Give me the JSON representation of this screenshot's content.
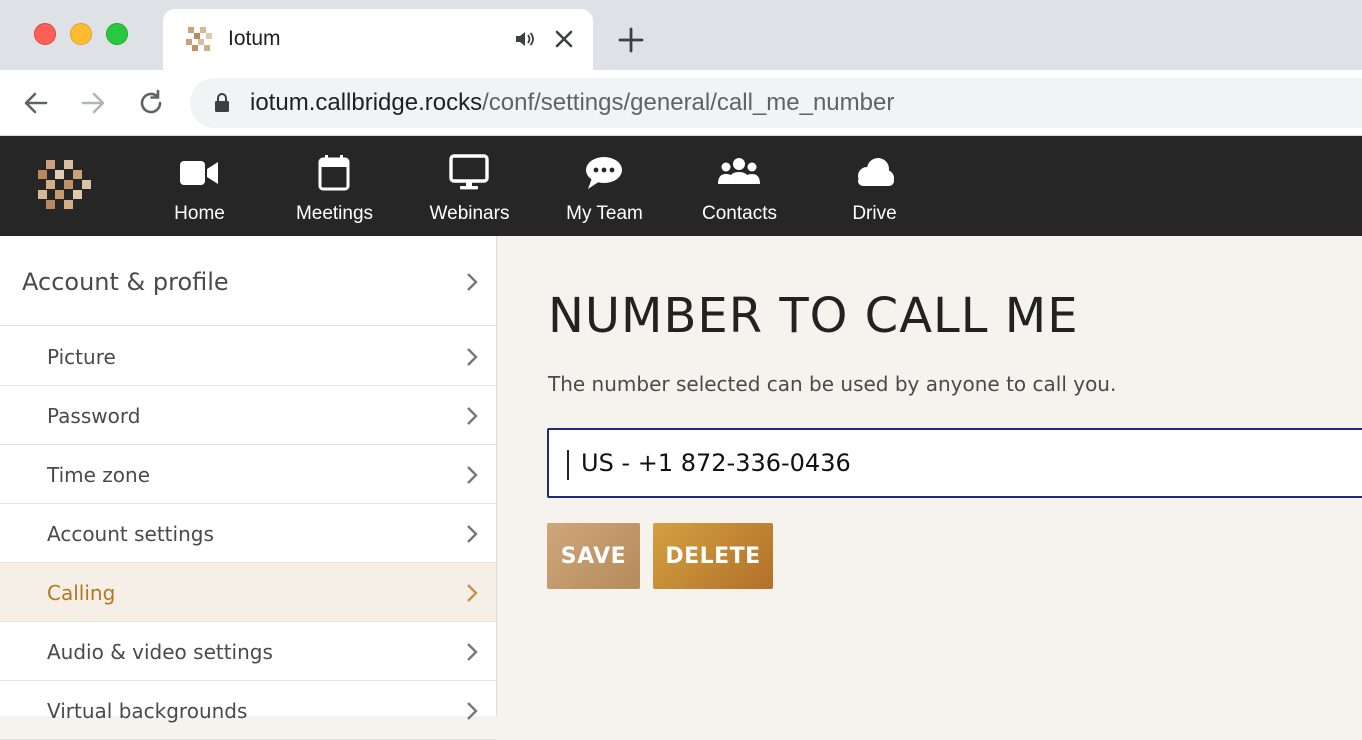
{
  "browser": {
    "tab": {
      "title": "Iotum"
    },
    "url": {
      "host": "iotum.callbridge.rocks",
      "path": "/conf/settings/general/call_me_number"
    }
  },
  "app": {
    "nav": [
      {
        "label": "Home",
        "icon": "video-camera-icon"
      },
      {
        "label": "Meetings",
        "icon": "calendar-icon"
      },
      {
        "label": "Webinars",
        "icon": "monitor-icon"
      },
      {
        "label": "My Team",
        "icon": "chat-bubble-icon"
      },
      {
        "label": "Contacts",
        "icon": "users-icon"
      },
      {
        "label": "Drive",
        "icon": "cloud-icon"
      }
    ]
  },
  "sidebar": {
    "header": "Account & profile",
    "items": [
      {
        "label": "Picture"
      },
      {
        "label": "Password"
      },
      {
        "label": "Time zone"
      },
      {
        "label": "Account settings"
      },
      {
        "label": "Calling",
        "active": true
      },
      {
        "label": "Audio & video settings"
      },
      {
        "label": "Virtual backgrounds"
      }
    ]
  },
  "main": {
    "title": "NUMBER TO CALL ME",
    "description": "The number selected can be used by anyone to call you.",
    "selected_number": "US - +1 872-336-0436",
    "save_label": "SAVE",
    "delete_label": "DELETE"
  },
  "colors": {
    "appbar": "#262626",
    "accent": "#b4771f",
    "focus_border": "#1f2a7a"
  }
}
